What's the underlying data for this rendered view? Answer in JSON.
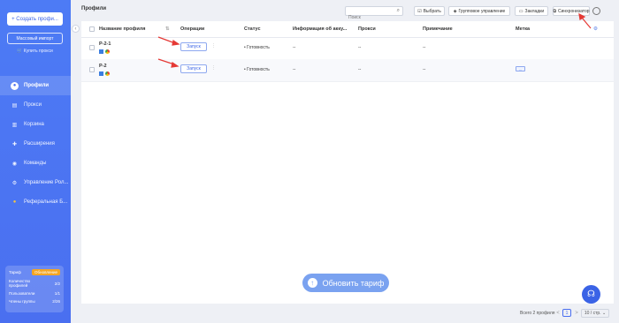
{
  "sidebar": {
    "create_label": "+ Создать профи...",
    "import_label": "Массовый импорт",
    "buy_proxy_label": "Купить прокси",
    "items": [
      {
        "label": "Профили",
        "icon": "profiles-icon",
        "active": true
      },
      {
        "label": "Прокси",
        "icon": "proxy-icon"
      },
      {
        "label": "Корзина",
        "icon": "trash-icon"
      },
      {
        "label": "Расширения",
        "icon": "extensions-icon"
      },
      {
        "label": "Команды",
        "icon": "team-icon"
      },
      {
        "label": "Управление Рол...",
        "icon": "roles-icon"
      },
      {
        "label": "Реферальная Б...",
        "icon": "referral-icon"
      }
    ],
    "plan": {
      "label": "Тариф",
      "badge": "Обновление",
      "rows": [
        {
          "label": "Количество профилей",
          "value": "2/2"
        },
        {
          "label": "Пользователи",
          "value": "1/1"
        },
        {
          "label": "Члены группы",
          "value": "2/26"
        }
      ]
    }
  },
  "header": {
    "title": "Профили",
    "search_placeholder": "Поиск",
    "buttons": [
      {
        "label": "Выбрать",
        "icon": "check-icon"
      },
      {
        "label": "Групповое управление",
        "icon": "layers-icon"
      },
      {
        "label": "Закладки",
        "icon": "bookmark-icon"
      },
      {
        "label": "Синхронизатор",
        "icon": "sync-icon"
      }
    ]
  },
  "table": {
    "columns": [
      "Название профиля",
      "Операции",
      "Статус",
      "Информация об акку...",
      "Прокси",
      "Примечание",
      "Метка"
    ],
    "rows": [
      {
        "name": "P-2-1",
        "launch": "Запуск",
        "status": "Готовность",
        "account": "--",
        "proxy": "--",
        "note": "--",
        "tag": "--"
      },
      {
        "name": "P-2",
        "launch": "Запуск",
        "status": "Готовность",
        "account": "--",
        "proxy": "--",
        "note": "--",
        "tag": "--"
      }
    ]
  },
  "footer": {
    "total": "Всего 2 профиля",
    "prev": "<",
    "page": "1",
    "next": ">",
    "per_page": "10 / стр."
  },
  "upgrade_label": "Обновить тариф",
  "colors": {
    "accent": "#4a6ff0",
    "annotation": "#e53935"
  }
}
